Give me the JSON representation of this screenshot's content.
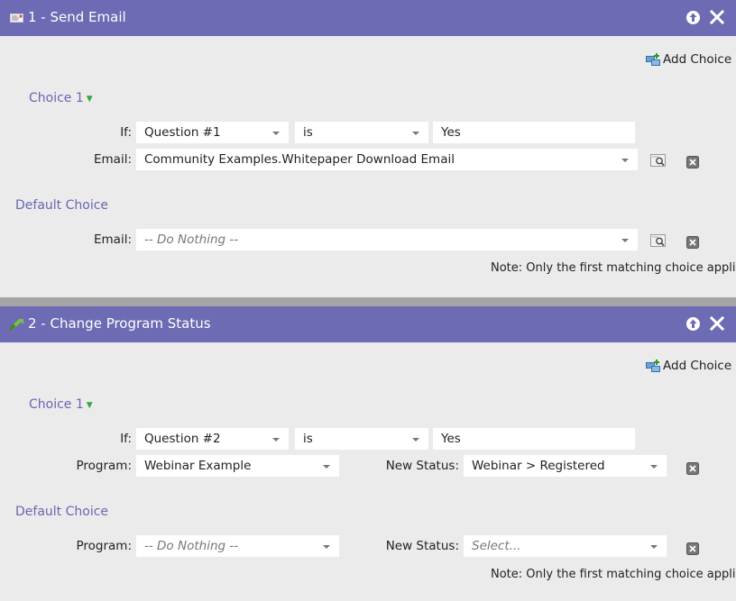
{
  "steps": [
    {
      "title": "1 - Send Email",
      "add_choice_label": "Add Choice",
      "choice": {
        "label": "Choice 1",
        "if_label": "If:",
        "condition_field": "Question #1",
        "operator": "is",
        "value": "Yes",
        "email_label": "Email:",
        "email_value": "Community Examples.Whitepaper Download Email"
      },
      "default_choice": {
        "label": "Default Choice",
        "email_label": "Email:",
        "email_value": "-- Do Nothing --"
      },
      "note": "Note: Only the first matching choice applies"
    },
    {
      "title": "2 - Change Program Status",
      "add_choice_label": "Add Choice",
      "choice": {
        "label": "Choice 1",
        "if_label": "If:",
        "condition_field": "Question #2",
        "operator": "is",
        "value": "Yes",
        "program_label": "Program:",
        "program_value": "Webinar Example",
        "status_label": "New Status:",
        "status_value": "Webinar > Registered"
      },
      "default_choice": {
        "label": "Default Choice",
        "program_label": "Program:",
        "program_value": "-- Do Nothing --",
        "status_label": "New Status:",
        "status_value": "Select..."
      },
      "note": "Note: Only the first matching choice applies"
    }
  ],
  "colors": {
    "header_bg": "#6c6bb4",
    "panel_bg": "#ebebeb",
    "link": "#6a67b3",
    "divider": "#a4a4a4"
  },
  "icons": {
    "step1": "email-icon",
    "step2": "program-status-icon",
    "move_up": "arrow-up-icon",
    "remove": "close-icon",
    "add_choice": "add-choice-icon",
    "preview": "preview-icon",
    "delete_choice": "delete-icon",
    "expand": "triangle-down-icon"
  }
}
